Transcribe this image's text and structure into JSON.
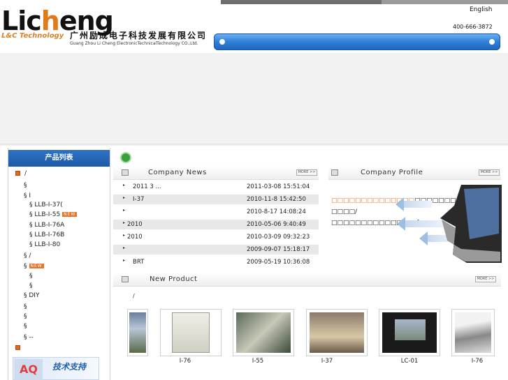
{
  "header": {
    "logo_word": "Licheng",
    "logo_sub": "L&C Technology",
    "logo_cn": "广州励成电子科技发展有限公司",
    "logo_en": "Guang Zhou Li Cheng ElectronicTechnicalTechnology CO.,Ltd.",
    "lang": "English",
    "phone": "400-666-3872"
  },
  "sidebar": {
    "title": "产品列表",
    "items": [
      {
        "text": "/",
        "marker": "orange"
      },
      {
        "text": "§"
      },
      {
        "text": "§      I"
      },
      {
        "text": "§  LLB-I-37("
      },
      {
        "text": "§  LLB-I-55",
        "new": "NEW"
      },
      {
        "text": "§  LLB-I-76A"
      },
      {
        "text": "§  LLB-I-76B"
      },
      {
        "text": "§  LLB-I-80"
      },
      {
        "text": "§      /"
      },
      {
        "text": "§",
        "new": "NEW"
      },
      {
        "text": "§"
      },
      {
        "text": "§"
      },
      {
        "text": "§          DIY"
      },
      {
        "text": "§"
      },
      {
        "text": "§"
      },
      {
        "text": "§"
      },
      {
        "text": "§        --"
      },
      {
        "text": "",
        "marker": "orange"
      }
    ],
    "support_tile": "AQ",
    "support_label": "技术支持"
  },
  "news": {
    "title": "Company News",
    "more": "MORE >>",
    "rows": [
      {
        "title": "2011 3    ...",
        "date": "2011-03-08 15:51:04"
      },
      {
        "title": "I-37",
        "date": "2010-11-8 15:42:50"
      },
      {
        "title": "",
        "date": "2010-8-17 14:08:24"
      },
      {
        "title": "2010",
        "date": "2010-05-06 9:40:49"
      },
      {
        "title": "2010",
        "date": "2010-03-09 09:32:23"
      },
      {
        "title": "",
        "date": "2009-09-07 15:18:17"
      },
      {
        "title": "  BRT",
        "date": "2009-05-19 10:36:08"
      }
    ]
  },
  "profile": {
    "title": "Company Profile",
    "more": "MORE >>",
    "highlight": "□□□□□□□□□□□□□□",
    "text1": "□□□□□□□□□/□□□□/",
    "text2": "□□□□□□□□□□□□……",
    "link": "[□□□□]"
  },
  "products": {
    "title": "New Product",
    "more": "MORE >>",
    "category": "/",
    "items": [
      {
        "label": ""
      },
      {
        "label": "I-76"
      },
      {
        "label": "I-55"
      },
      {
        "label": "I-37"
      },
      {
        "label": "LC-01"
      },
      {
        "label": "I-76"
      }
    ]
  }
}
